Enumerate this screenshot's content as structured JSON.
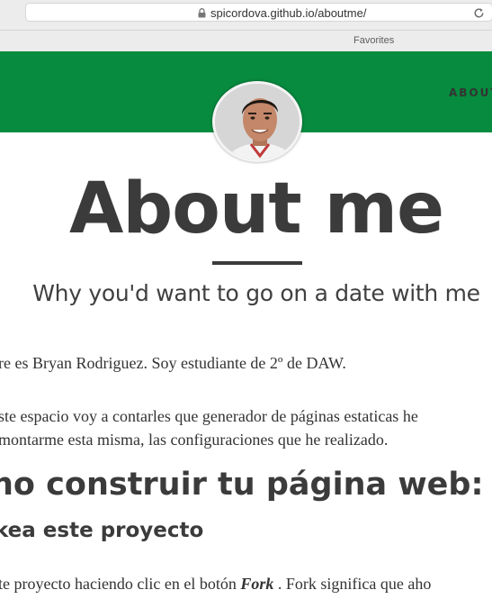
{
  "browser": {
    "url": "spicordova.github.io/aboutme/",
    "favorites_label": "Favorites"
  },
  "nav": {
    "link_label": "ABOUT"
  },
  "header": {
    "title": "About me",
    "subtitle": "Why you'd want to go on a date with me"
  },
  "content": {
    "para1": "re es Bryan Rodriguez. Soy estudiante de 2º de DAW.",
    "para2_line1": "ste espacio voy a contarles que generador de páginas estaticas he",
    "para2_line2": "montarme esta misma, las configuraciones que he realizado.",
    "heading": "no construir tu página web:",
    "subheading": "kea este proyecto",
    "para3_before": "te proyecto haciendo clic en el botón ",
    "para3_bold": "Fork",
    "para3_after": " . Fork significa que aho"
  },
  "icons": {
    "lock": "lock-icon",
    "reload": "reload-icon"
  },
  "colors": {
    "nav_green": "#078b3f",
    "text_dark": "#3b3b3b"
  }
}
